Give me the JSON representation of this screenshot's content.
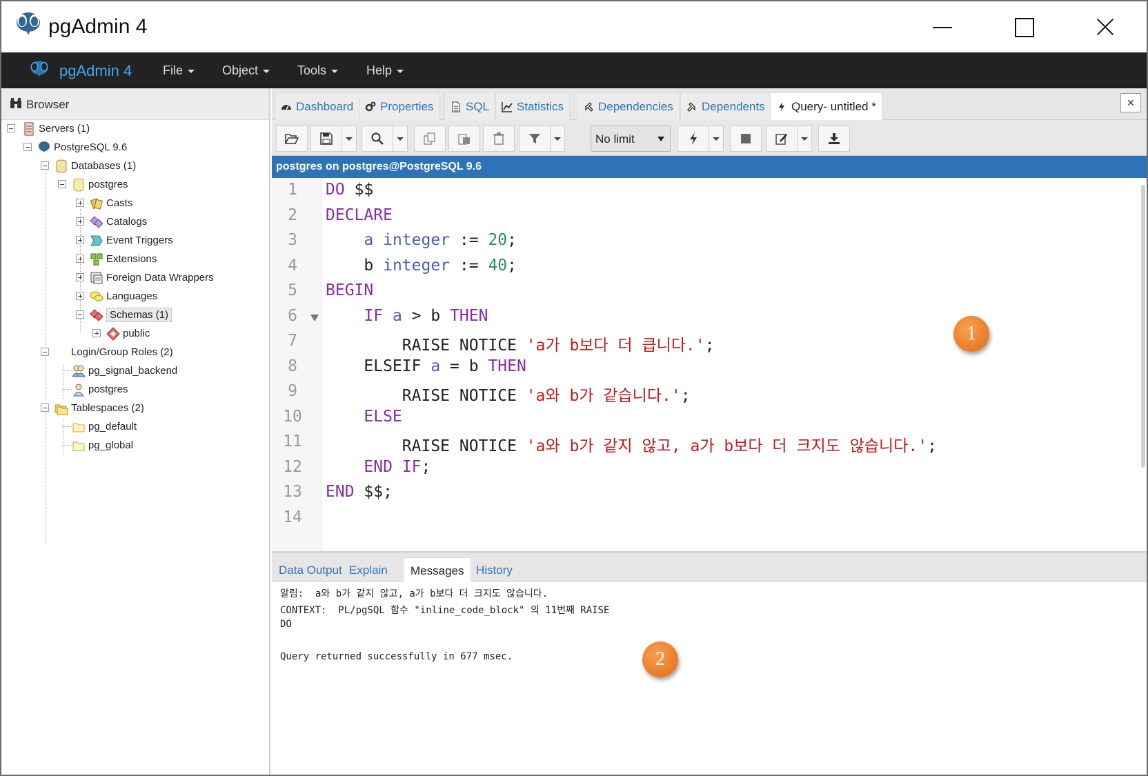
{
  "window": {
    "title": "pgAdmin 4"
  },
  "menubar": {
    "brand": "pgAdmin 4",
    "items": [
      "File",
      "Object",
      "Tools",
      "Help"
    ]
  },
  "browser": {
    "title": "Browser",
    "tree": {
      "servers": "Servers (1)",
      "server": "PostgreSQL 9.6",
      "databases": "Databases (1)",
      "db_postgres": "postgres",
      "casts": "Casts",
      "catalogs": "Catalogs",
      "event_triggers": "Event Triggers",
      "extensions": "Extensions",
      "fdw": "Foreign Data Wrappers",
      "languages": "Languages",
      "schemas": "Schemas (1)",
      "public": "public",
      "login_roles": "Login/Group Roles (2)",
      "role_signal": "pg_signal_backend",
      "role_postgres": "postgres",
      "tablespaces": "Tablespaces (2)",
      "ts_default": "pg_default",
      "ts_global": "pg_global"
    }
  },
  "tabs": [
    "Dashboard",
    "Properties",
    "SQL",
    "Statistics",
    "Dependencies",
    "Dependents",
    "Query- untitled *"
  ],
  "toolbar": {
    "limit": "No limit"
  },
  "connection": "postgres on postgres@PostgreSQL 9.6",
  "editor": {
    "line_numbers": [
      "1",
      "2",
      "3",
      "4",
      "5",
      "6",
      "7",
      "8",
      "9",
      "10",
      "11",
      "12",
      "13",
      "14"
    ],
    "lines": {
      "l1": {
        "kw": "DO",
        "rest": " $$"
      },
      "l2": {
        "kw": "DECLARE"
      },
      "l3": {
        "var": "a",
        "type": "integer",
        "op": " := ",
        "num": "20",
        "end": ";"
      },
      "l4": {
        "var": "b",
        "type": "integer",
        "op": " := ",
        "num": "40",
        "end": ";"
      },
      "l5": {
        "kw": "BEGIN"
      },
      "l6": {
        "kw": "IF",
        "a": "a",
        "mid": " > b ",
        "kw2": "THEN"
      },
      "l7": {
        "pre": "RAISE NOTICE ",
        "str": "'a가 b보다 더 큽니다.'",
        "end": ";"
      },
      "l8": {
        "pre": "ELSEIF ",
        "a": "a",
        "mid": " = b ",
        "kw2": "THEN"
      },
      "l9": {
        "pre": "RAISE NOTICE ",
        "str": "'a와 b가 같습니다.'",
        "end": ";"
      },
      "l10": {
        "kw": "ELSE"
      },
      "l11": {
        "pre": "RAISE NOTICE ",
        "str": "'a와 b가 같지 않고, a가 b보다 더 크지도 않습니다.'",
        "end": ";"
      },
      "l12": {
        "kw": "END IF",
        "end": ";"
      },
      "l13": {
        "kw": "END",
        "rest": " $$;"
      }
    }
  },
  "badges": {
    "one": "1",
    "two": "2"
  },
  "output_tabs": [
    "Data Output",
    "Explain",
    "Messages",
    "History"
  ],
  "messages": [
    "알림:  a와 b가 같지 않고, a가 b보다 더 크지도 않습니다.",
    "CONTEXT:  PL/pgSQL 함수 \"inline_code_block\" 의 11번째 RAISE",
    "DO",
    "",
    "Query returned successfully in 677 msec."
  ]
}
